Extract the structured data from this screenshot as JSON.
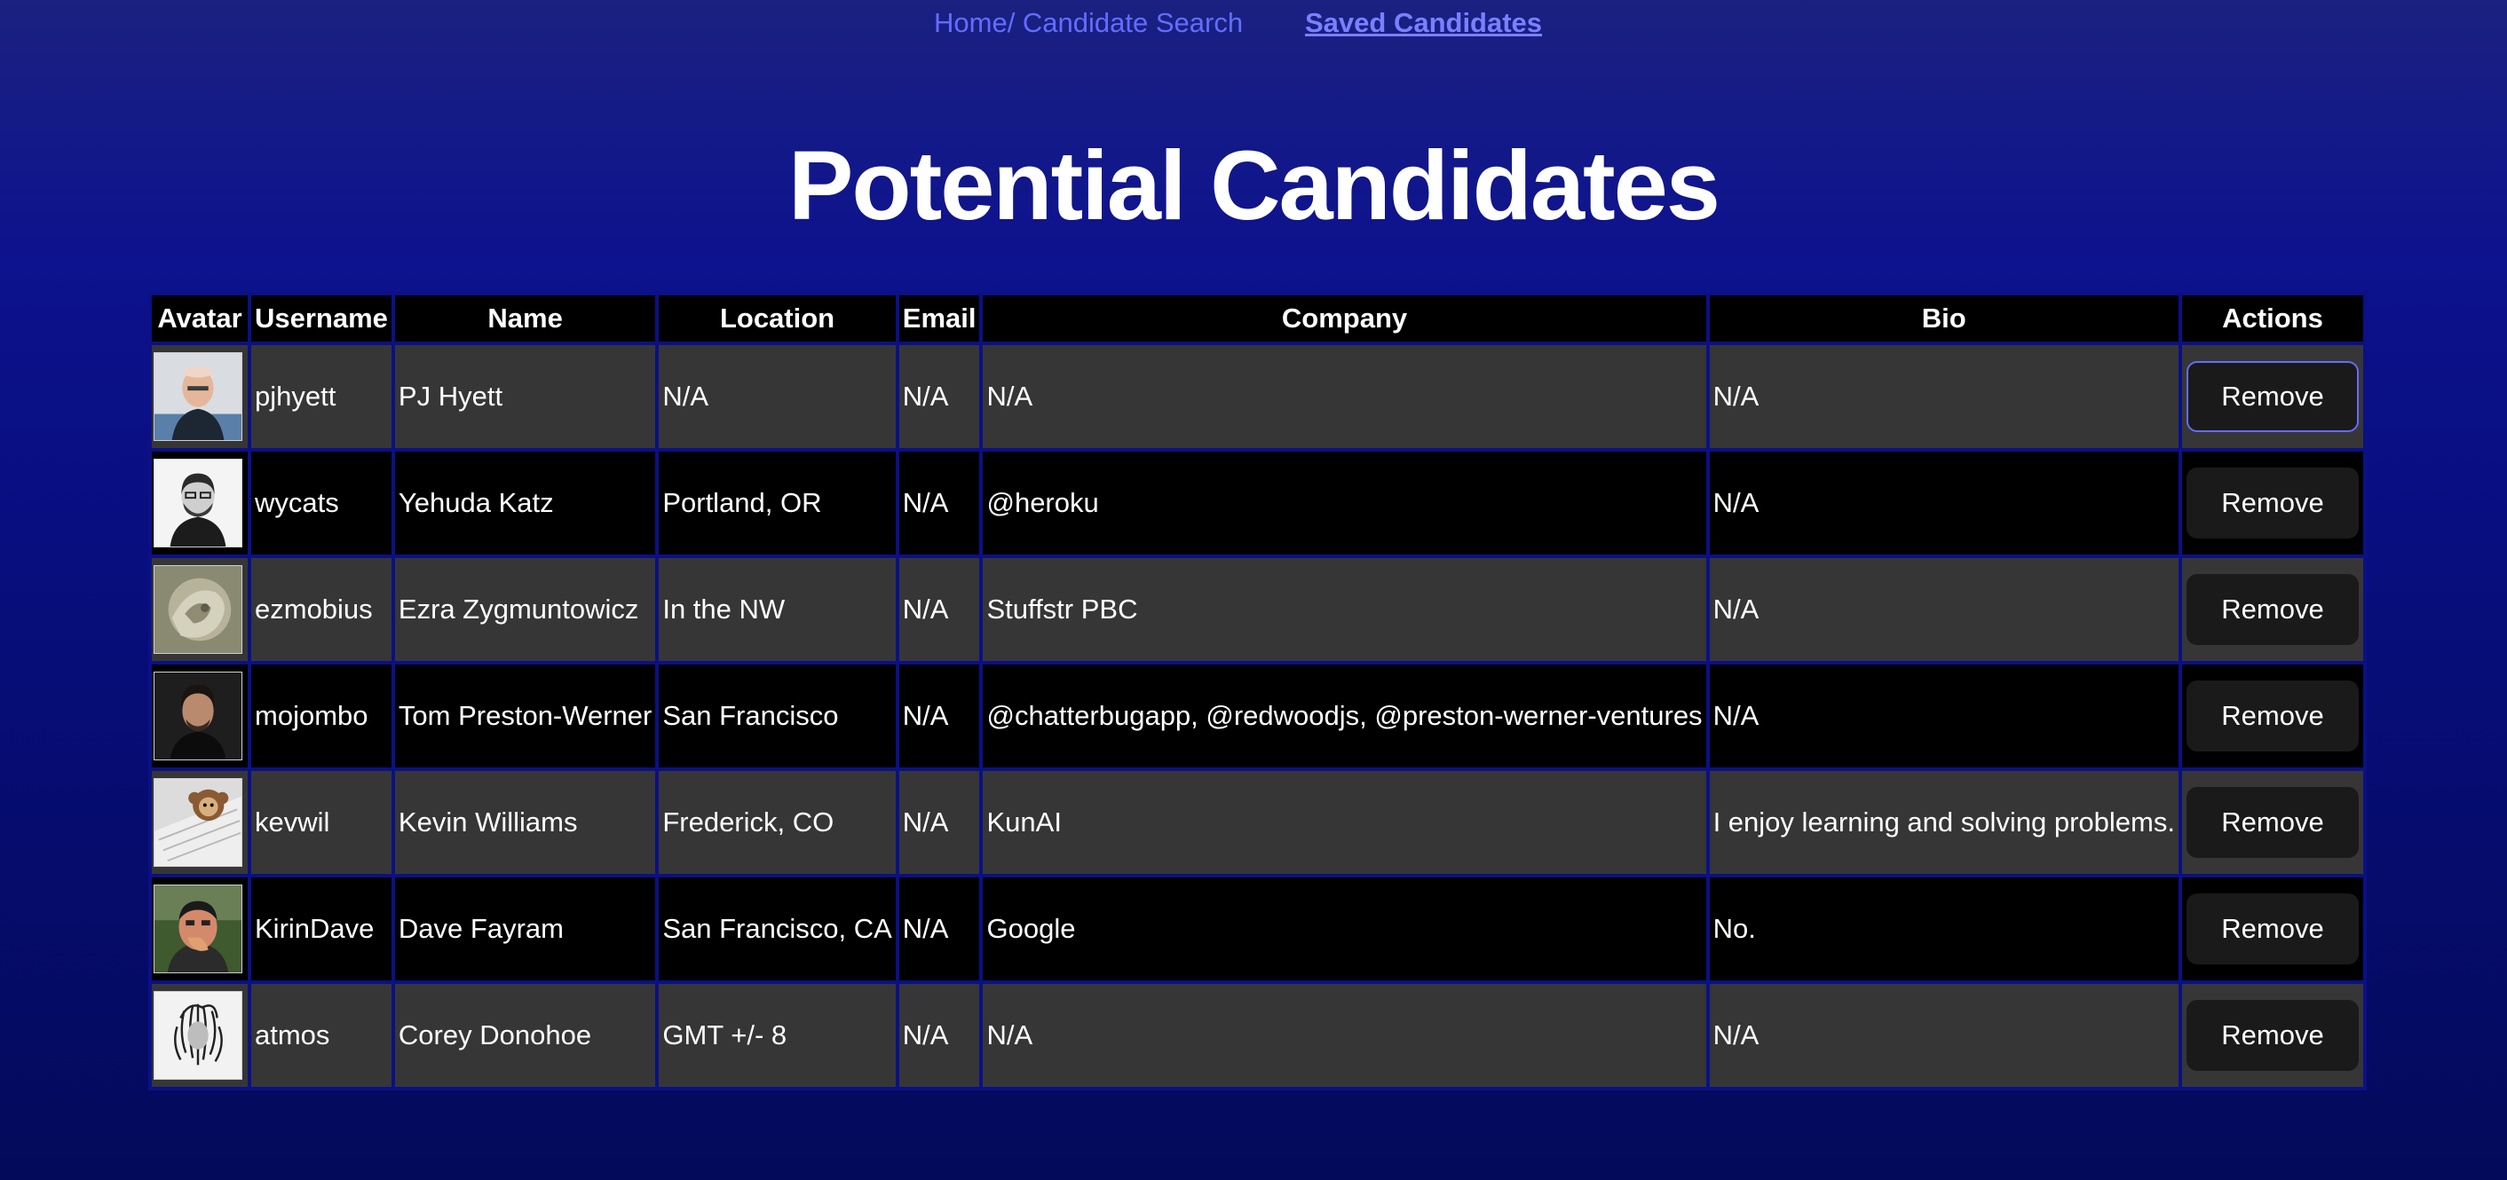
{
  "nav": {
    "home_label": "Home/ Candidate Search",
    "saved_label": "Saved Candidates"
  },
  "page_title": "Potential Candidates",
  "table": {
    "headers": [
      "Avatar",
      "Username",
      "Name",
      "Location",
      "Email",
      "Company",
      "Bio",
      "Actions"
    ],
    "remove_label": "Remove",
    "rows": [
      {
        "username": "pjhyett",
        "name": "PJ Hyett",
        "location": "N/A",
        "email": "N/A",
        "company": "N/A",
        "bio": "N/A"
      },
      {
        "username": "wycats",
        "name": "Yehuda Katz",
        "location": "Portland, OR",
        "email": "N/A",
        "company": "@heroku",
        "bio": "N/A"
      },
      {
        "username": "ezmobius",
        "name": "Ezra Zygmuntowicz",
        "location": "In the NW",
        "email": "N/A",
        "company": "Stuffstr PBC",
        "bio": "N/A"
      },
      {
        "username": "mojombo",
        "name": "Tom Preston-Werner",
        "location": "San Francisco",
        "email": "N/A",
        "company": "@chatterbugapp, @redwoodjs, @preston-werner-ventures",
        "bio": "N/A"
      },
      {
        "username": "kevwil",
        "name": "Kevin Williams",
        "location": "Frederick, CO",
        "email": "N/A",
        "company": "KunAI",
        "bio": "I enjoy learning and solving problems."
      },
      {
        "username": "KirinDave",
        "name": "Dave Fayram",
        "location": "San Francisco, CA",
        "email": "N/A",
        "company": "Google",
        "bio": "No."
      },
      {
        "username": "atmos",
        "name": "Corey Donohoe",
        "location": "GMT +/- 8",
        "email": "N/A",
        "company": "N/A",
        "bio": "N/A"
      }
    ]
  }
}
